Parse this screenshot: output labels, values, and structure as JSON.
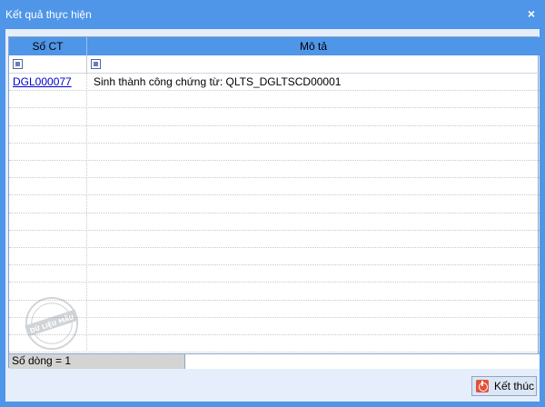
{
  "window": {
    "title": "Kết quả thực hiện",
    "close_glyph": "×"
  },
  "grid": {
    "columns": [
      "Số CT",
      "Mô tả"
    ],
    "rows": [
      {
        "so_ct": "DGL000077",
        "mo_ta": "Sinh thành công chứng từ: QLTS_DGLTSCD00001"
      }
    ],
    "status_text": "Số dòng = 1",
    "watermark_text": "DỮ LIỆU MẪU"
  },
  "footer": {
    "finish_label": "Kết thúc"
  },
  "colors": {
    "title_bar": "#4f95e8",
    "client_bg": "#e6eefb",
    "link": "#0000cc",
    "finish_icon": "#e0533a"
  },
  "icons": {
    "close": "close-icon",
    "filter": "filter-icon",
    "finish": "power-icon"
  }
}
